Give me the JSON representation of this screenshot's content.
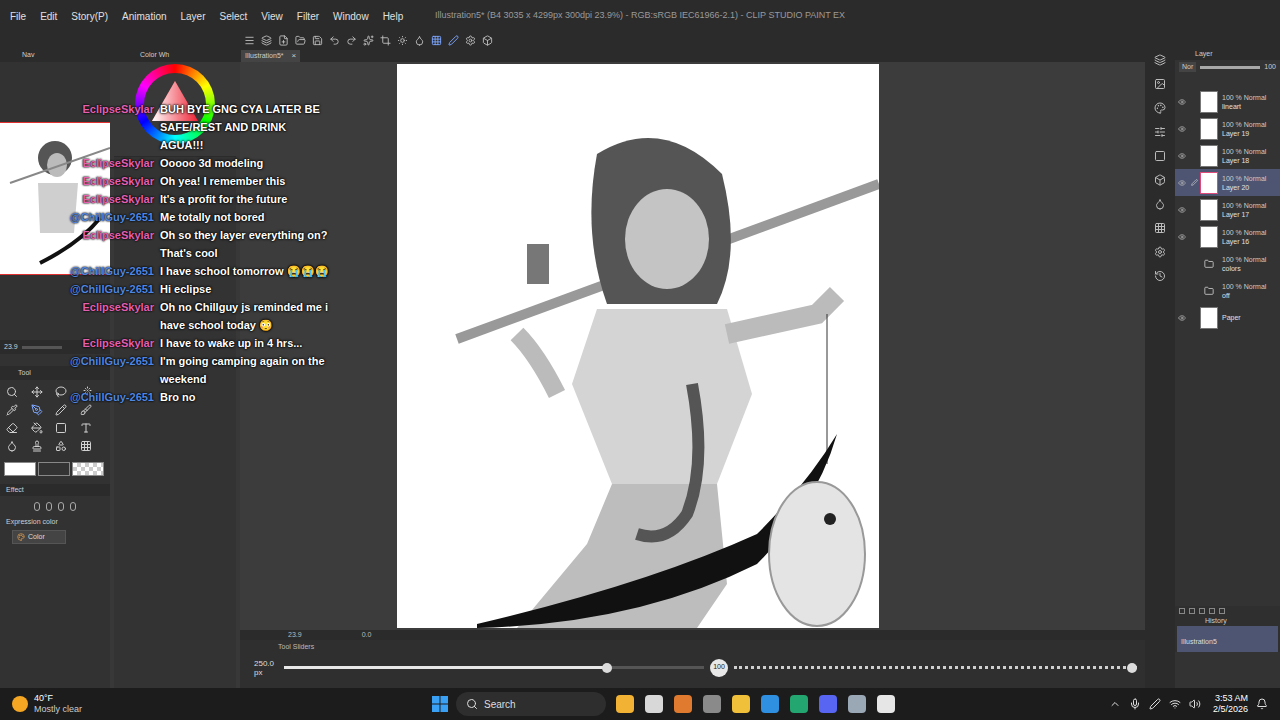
{
  "window": {
    "title": "Illustration5* (B4 3035 x 4299px 300dpi 23.9%) - RGB:sRGB IEC61966-2.1) - CLIP STUDIO PAINT EX"
  },
  "menu": [
    "File",
    "Edit",
    "Story(P)",
    "Animation",
    "Layer",
    "Select",
    "View",
    "Filter",
    "Window",
    "Help"
  ],
  "left_panel": {
    "navigator_tab": "Nav",
    "color_tab": "Color Wh",
    "zoom": "23.9",
    "tool_header": "Tool",
    "effect_header": "Effect",
    "expression_label": "Expression color",
    "expression_value": "Color"
  },
  "canvas_tab": {
    "label": "Illustration5*",
    "close": "×"
  },
  "chat": [
    {
      "user": "EclipseSkylar",
      "text": "BUH BYE GNG CYA LATER BE SAFE/REST AND DRINK AGUA!!!",
      "color": "#e35fb0"
    },
    {
      "user": "EclipseSkylar",
      "text": "Ooooo 3d modeling",
      "color": "#e35fb0"
    },
    {
      "user": "EclipseSkylar",
      "text": "Oh yea! I remember this",
      "color": "#e35fb0"
    },
    {
      "user": "EclipseSkylar",
      "text": "It's a profit for the future",
      "color": "#e35fb0"
    },
    {
      "user": "@ChillGuy-2651",
      "text": "Me totally not bored",
      "color": "#4f86e0"
    },
    {
      "user": "EclipseSkylar",
      "text": "Oh so they layer everything on? That's cool",
      "color": "#e35fb0"
    },
    {
      "user": "@ChillGuy-2651",
      "text": "I have school tomorrow 😭😭😭",
      "color": "#4f86e0"
    },
    {
      "user": "@ChillGuy-2651",
      "text": "Hi eclipse",
      "color": "#4f86e0"
    },
    {
      "user": "EclipseSkylar",
      "text": "Oh no Chillguy js reminded me i have school today 😳",
      "color": "#e35fb0"
    },
    {
      "user": "EclipseSkylar",
      "text": "I have to wake up in 4 hrs...",
      "color": "#e35fb0"
    },
    {
      "user": "@ChillGuy-2651",
      "text": "I'm going camping again on the weekend",
      "color": "#4f86e0"
    },
    {
      "user": "@ChillGuy-2651",
      "text": "Bro no",
      "color": "#4f86e0"
    }
  ],
  "canvas_status": {
    "zoom": "23.9",
    "rotation": "0.0"
  },
  "tool_sliders": {
    "header": "Tool Sliders",
    "size": "250.0",
    "unit": "px",
    "size_level": 0.77,
    "opacity": "100",
    "opacity_level": 1
  },
  "layer_panel": {
    "header": "Layer",
    "blend": "Nor",
    "opacity": "100"
  },
  "layers": [
    {
      "opacity": "100 % Normal",
      "name": "lineart",
      "kind": "layer",
      "visible": true,
      "selected": false
    },
    {
      "opacity": "100 % Normal",
      "name": "Layer 19",
      "kind": "layer",
      "visible": true,
      "selected": false
    },
    {
      "opacity": "100 % Normal",
      "name": "Layer 18",
      "kind": "layer",
      "visible": true,
      "selected": false
    },
    {
      "opacity": "100 % Normal",
      "name": "Layer 20",
      "kind": "layer",
      "visible": true,
      "selected": true
    },
    {
      "opacity": "100 % Normal",
      "name": "Layer 17",
      "kind": "layer",
      "visible": true,
      "selected": false
    },
    {
      "opacity": "100 % Normal",
      "name": "Layer 16",
      "kind": "layer",
      "visible": true,
      "selected": false
    },
    {
      "opacity": "100 % Normal",
      "name": "colors",
      "kind": "folder",
      "visible": false,
      "selected": false
    },
    {
      "opacity": "100 % Normal",
      "name": "off",
      "kind": "folder",
      "visible": false,
      "selected": false
    },
    {
      "opacity": "",
      "name": "Paper",
      "kind": "paper",
      "visible": true,
      "selected": false
    }
  ],
  "history": {
    "header": "History",
    "items": [
      "Illustration5"
    ]
  },
  "taskbar": {
    "temperature": "40°F",
    "weather": "Mostly clear",
    "search": "Search",
    "time": "3:53 AM",
    "date": "2/5/2026"
  }
}
